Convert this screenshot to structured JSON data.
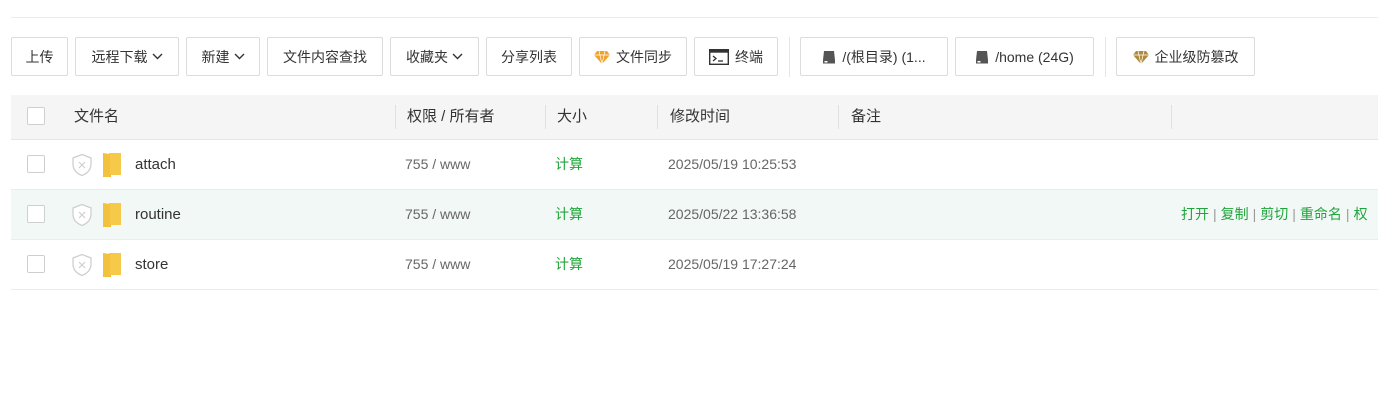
{
  "toolbar": {
    "upload": "上传",
    "remote_download": "远程下载",
    "new": "新建",
    "content_search": "文件内容查找",
    "favorites": "收藏夹",
    "share_list": "分享列表",
    "file_sync": "文件同步",
    "terminal": "终端",
    "disk_root": "/(根目录) (1...",
    "disk_home": "/home (24G)",
    "tamper_proof": "企业级防篡改"
  },
  "table": {
    "headers": {
      "name": "文件名",
      "perm_owner": "权限 / 所有者",
      "size": "大小",
      "mtime": "修改时间",
      "note": "备注"
    },
    "rows": [
      {
        "name": "attach",
        "perm": "755 / www",
        "size": "计算",
        "mtime": "2025/05/19 10:25:53"
      },
      {
        "name": "routine",
        "perm": "755 / www",
        "size": "计算",
        "mtime": "2025/05/22 13:36:58"
      },
      {
        "name": "store",
        "perm": "755 / www",
        "size": "计算",
        "mtime": "2025/05/19 17:27:24"
      }
    ],
    "row_actions": [
      "打开",
      "复制",
      "剪切",
      "重命名",
      "权"
    ]
  },
  "colors": {
    "accent_green": "#20a53a",
    "folder_yellow": "#f7c948",
    "diamond_orange": "#f0a22b",
    "diamond_brown": "#b08a3e"
  }
}
